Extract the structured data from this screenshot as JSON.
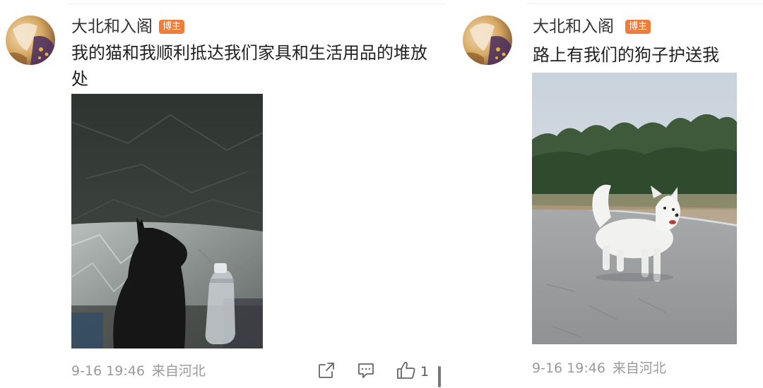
{
  "posts": [
    {
      "username": "大北和入阁",
      "badge": "博主",
      "text": "我的猫和我顺利抵达我们家具和生活用品的堆放处",
      "date": "9-16 19:46",
      "source": "来自河北",
      "like_count": "1",
      "icons": [
        "share-icon",
        "comment-icon",
        "like-icon"
      ]
    },
    {
      "username": "大北和入阁",
      "badge": "博主",
      "text": "路上有我们的狗子护送我",
      "date": "9-16 19:46",
      "source": "来自河北"
    }
  ],
  "colors": {
    "badge": "#f07c3a",
    "meta_text": "#9a9a9a",
    "body_text": "#222222"
  }
}
